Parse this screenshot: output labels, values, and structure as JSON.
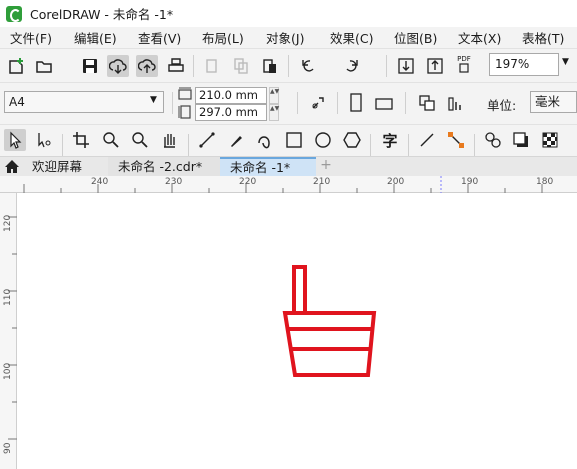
{
  "app": {
    "title": "CorelDRAW - 未命名 -1*"
  },
  "menu": {
    "items": [
      {
        "label": "文件(F)"
      },
      {
        "label": "编辑(E)"
      },
      {
        "label": "查看(V)"
      },
      {
        "label": "布局(L)"
      },
      {
        "label": "对象(J)"
      },
      {
        "label": "效果(C)"
      },
      {
        "label": "位图(B)"
      },
      {
        "label": "文本(X)"
      },
      {
        "label": "表格(T)"
      }
    ]
  },
  "standard_toolbar": {
    "pdf_label": "PDF",
    "zoom_value": "197%"
  },
  "property_bar": {
    "page_size": "A4",
    "width": "210.0 mm",
    "height": "297.0 mm",
    "unit_label": "单位:",
    "unit_value": "毫米"
  },
  "toolbox": {
    "text_tool_glyph": "字"
  },
  "tabs": {
    "welcome": "欢迎屏幕",
    "doc2": "未命名 -2.cdr*",
    "doc1": "未命名 -1*",
    "add": "+"
  },
  "rulers": {
    "horizontal": [
      "240",
      "230",
      "220",
      "210",
      "200",
      "190",
      "180"
    ],
    "vertical": [
      "120",
      "110",
      "100",
      "90"
    ]
  },
  "colors": {
    "shape_stroke": "#e0141e",
    "active_tab": "#cfe3f6",
    "toolbar_bg": "#f3f3f3"
  }
}
